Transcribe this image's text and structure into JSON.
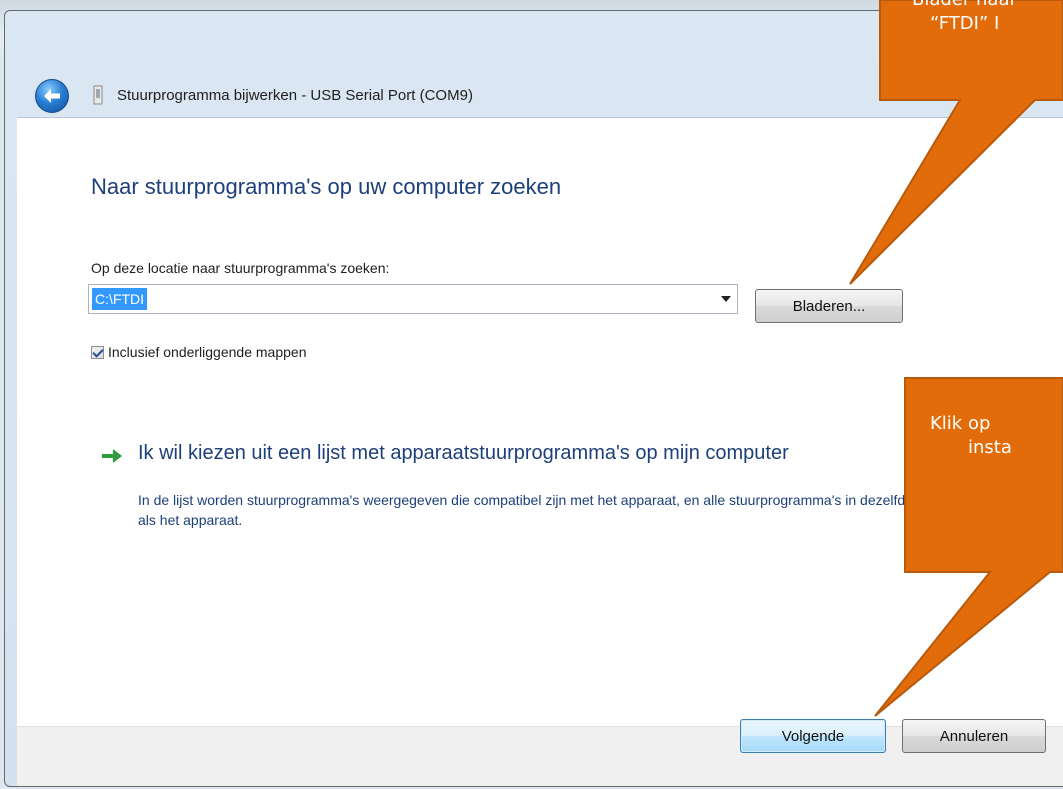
{
  "window": {
    "title": "Stuurprogramma bijwerken - USB Serial Port (COM9)"
  },
  "main": {
    "heading": "Naar stuurprogramma's op uw computer zoeken",
    "location_label": "Op deze locatie naar stuurprogramma's zoeken:",
    "location_value": "C:\\FTDI",
    "browse_label": "Bladeren...",
    "include_subfolders_label": "Inclusief onderliggende mappen",
    "include_subfolders_checked": true,
    "pick_link_title": "Ik wil kiezen uit een lijst met apparaatstuurprogramma's op mijn computer",
    "pick_link_description": "In de lijst worden stuurprogramma's weergegeven die compatibel zijn met het apparaat, en alle stuurprogramma's in dezelfde categorie als het apparaat."
  },
  "footer": {
    "next_label": "Volgende",
    "cancel_label": "Annuleren"
  },
  "annotations": {
    "callout_top_line1": "Blader naar",
    "callout_top_line2": "“FTDI” I",
    "callout_bottom_line1": "Klik op",
    "callout_bottom_line2": "insta",
    "callout_color": "#E36C0A"
  },
  "icons": {
    "back": "back-arrow-icon",
    "device": "usb-device-icon",
    "link_arrow": "green-arrow-icon",
    "combo_dropdown": "chevron-down-icon"
  },
  "colors": {
    "heading_blue": "#1D3F7A",
    "selection_blue": "#3399FF",
    "link_arrow_green": "#2E9E3E"
  }
}
